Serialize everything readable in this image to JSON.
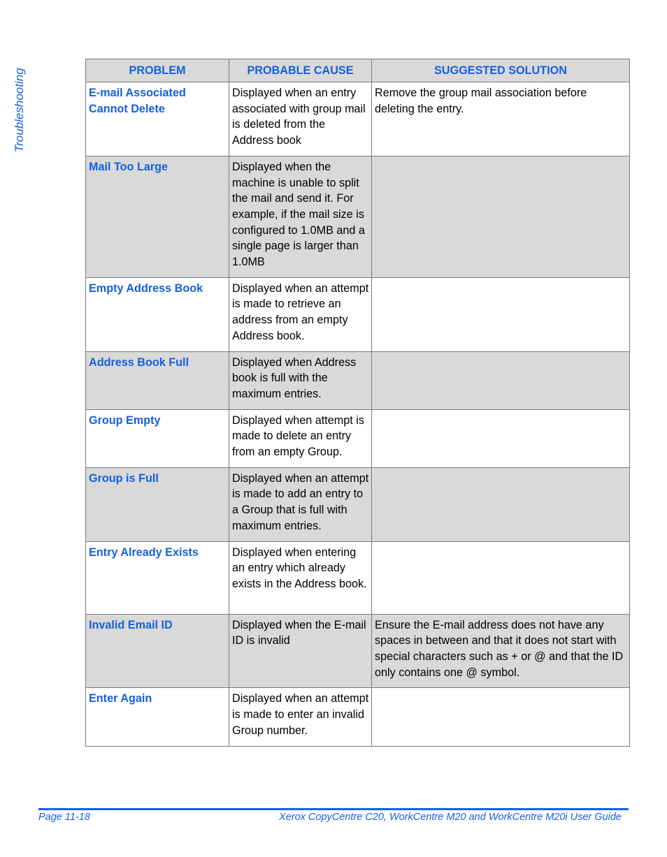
{
  "side_tab": "Troubleshooting",
  "table": {
    "headers": [
      "PROBLEM",
      "PROBABLE CAUSE",
      "SUGGESTED SOLUTION"
    ],
    "rows": [
      {
        "problem": "E-mail Associated Cannot Delete",
        "cause": "Displayed when an entry associated with group mail is deleted from the Address book",
        "solution": "Remove the group mail association before deleting the entry."
      },
      {
        "problem": "Mail Too Large",
        "cause": "Displayed when the machine is unable to split the mail and send it. For example, if the mail size is configured to 1.0MB and a single page is larger than 1.0MB",
        "solution": ""
      },
      {
        "problem": "Empty Address Book",
        "cause": "Displayed when an attempt is made to retrieve an address from an empty Address book.",
        "solution": ""
      },
      {
        "problem": "Address Book Full",
        "cause": "Displayed when Address book is full with the maximum entries.",
        "solution": ""
      },
      {
        "problem": "Group Empty",
        "cause": "Displayed when attempt is made to delete an entry from an empty Group.",
        "solution": ""
      },
      {
        "problem": "Group is Full",
        "cause": "Displayed when an attempt is made to add an entry to a Group that is full with maximum entries.",
        "solution": ""
      },
      {
        "problem": "Entry Already Exists",
        "cause": "Displayed when entering an entry which already exists in the Address book.",
        "solution": ""
      },
      {
        "problem": "Invalid Email ID",
        "cause": "Displayed when the E-mail ID is invalid",
        "solution": "Ensure the E-mail address does not have any spaces in between and that it does not start with special characters such as + or @ and that the ID only contains one @ symbol."
      },
      {
        "problem": "Enter Again",
        "cause": "Displayed when an attempt is made to enter an invalid Group number.",
        "solution": ""
      }
    ]
  },
  "footer": {
    "page": "Page 11-18",
    "guide_title": "Xerox CopyCentre C20, WorkCentre M20 and WorkCentre M20i User Guide"
  }
}
